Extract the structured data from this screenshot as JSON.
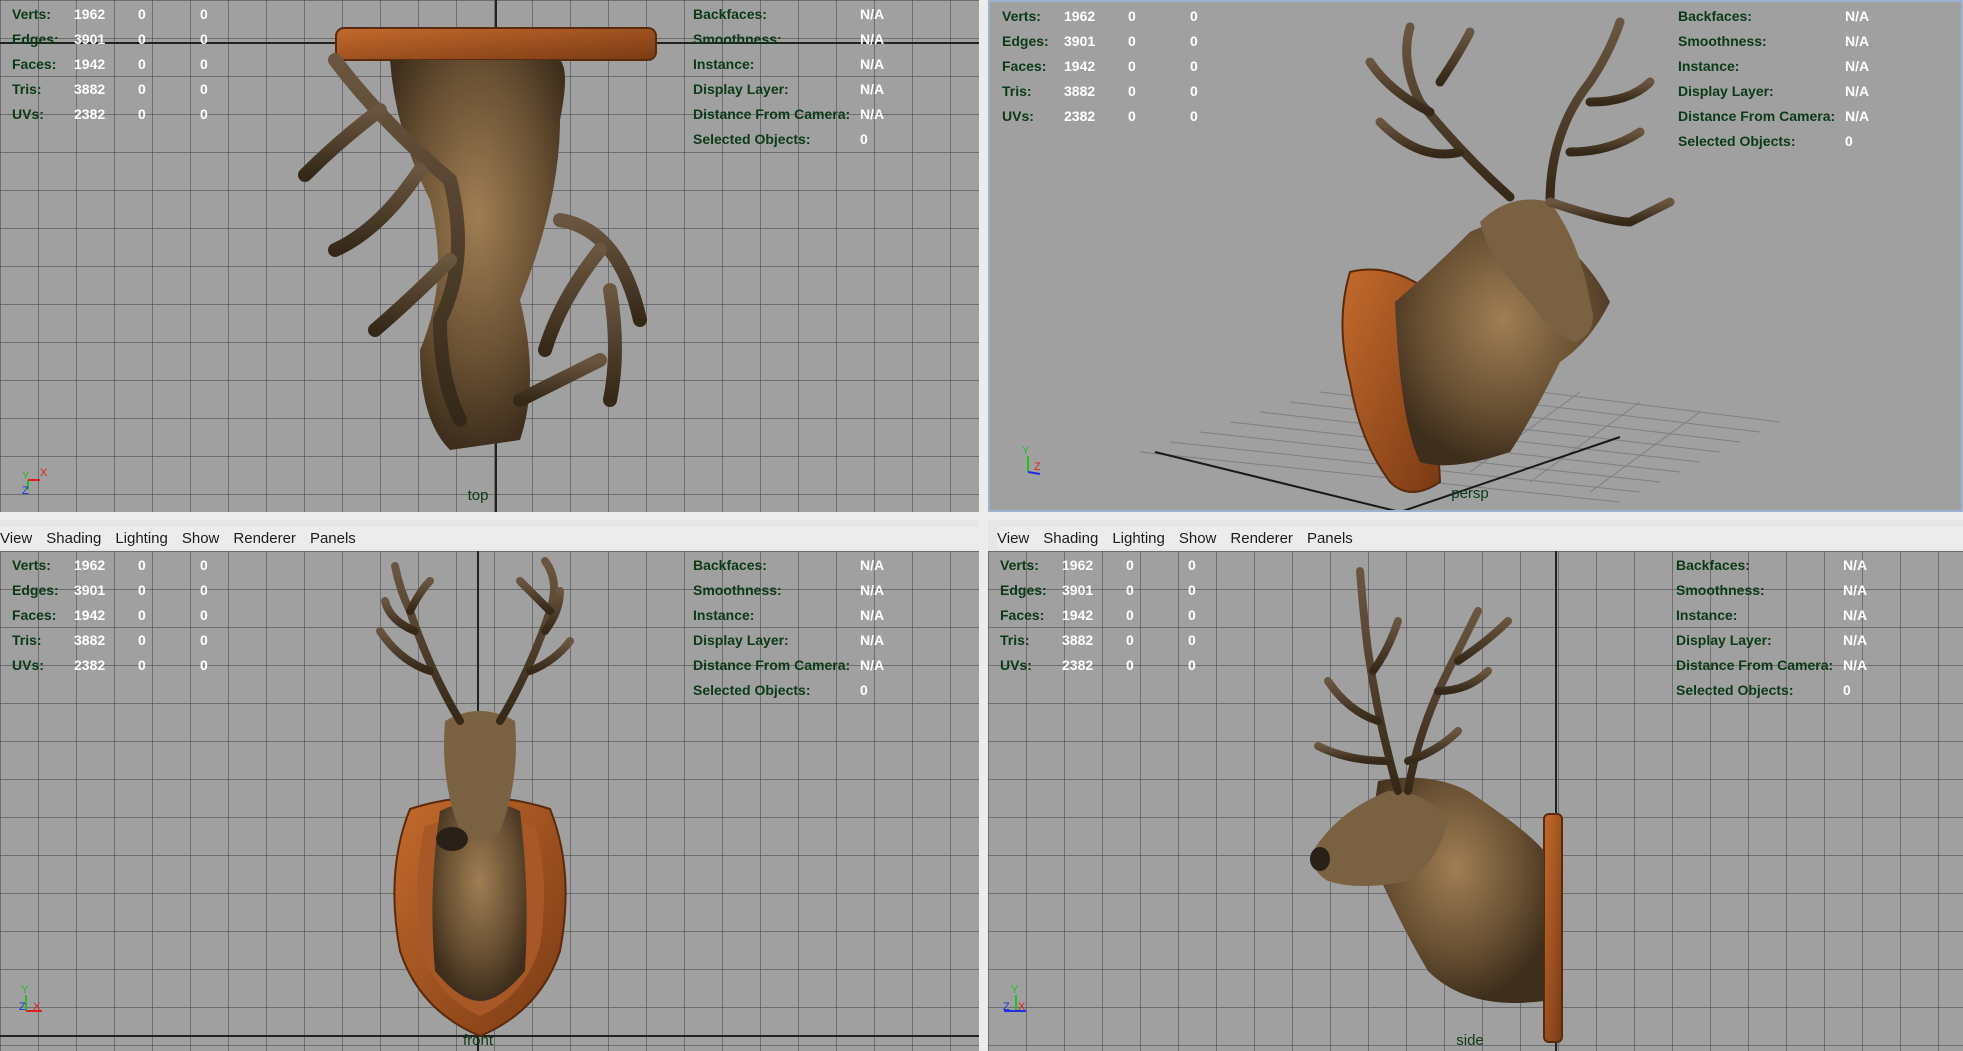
{
  "menu": [
    "View",
    "Shading",
    "Lighting",
    "Show",
    "Renderer",
    "Panels"
  ],
  "hud": {
    "stats": [
      {
        "label": "Verts:",
        "v1": "1962",
        "v2": "0",
        "v3": "0"
      },
      {
        "label": "Edges:",
        "v1": "3901",
        "v2": "0",
        "v3": "0"
      },
      {
        "label": "Faces:",
        "v1": "1942",
        "v2": "0",
        "v3": "0"
      },
      {
        "label": "Tris:",
        "v1": "3882",
        "v2": "0",
        "v3": "0"
      },
      {
        "label": "UVs:",
        "v1": "2382",
        "v2": "0",
        "v3": "0"
      }
    ],
    "props": [
      {
        "label": "Backfaces:",
        "value": "N/A"
      },
      {
        "label": "Smoothness:",
        "value": "N/A"
      },
      {
        "label": "Instance:",
        "value": "N/A"
      },
      {
        "label": "Display Layer:",
        "value": "N/A"
      },
      {
        "label": "Distance From Camera:",
        "value": "N/A"
      },
      {
        "label": "Selected Objects:",
        "value": "0"
      }
    ]
  },
  "viewports": {
    "top": {
      "camera": "top",
      "axes": [
        "Y",
        "X",
        "Z"
      ]
    },
    "persp": {
      "camera": "persp",
      "axes": [
        "Y",
        "Z"
      ]
    },
    "front": {
      "camera": "front",
      "axes": [
        "Y",
        "Z",
        "X"
      ]
    },
    "side": {
      "camera": "side",
      "axes": [
        "Y",
        "Z",
        "X"
      ]
    }
  },
  "colors": {
    "viewport_bg": "#a0a0a0",
    "hud_label": "#0a3a16",
    "hud_value": "#ffffff",
    "axis_x": "#e02020",
    "axis_y": "#20c020",
    "axis_z": "#2030e0",
    "antler": "#4a3826",
    "fur": "#6b5234",
    "plaque": "#9c4f1e"
  }
}
